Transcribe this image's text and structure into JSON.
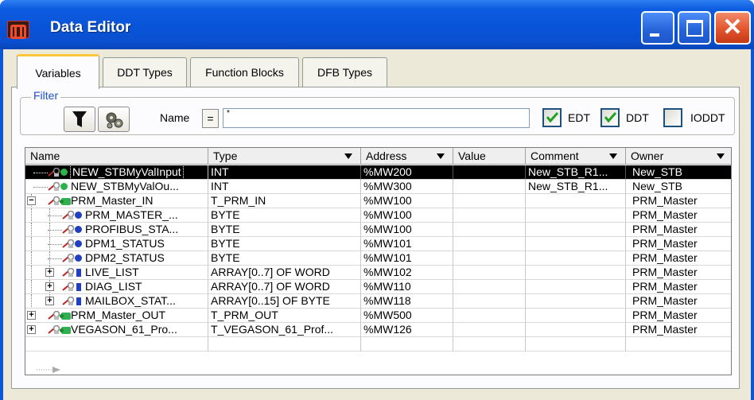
{
  "window": {
    "title": "Data Editor"
  },
  "tabs": [
    {
      "label": "Variables",
      "active": true
    },
    {
      "label": "DDT Types",
      "active": false
    },
    {
      "label": "Function Blocks",
      "active": false
    },
    {
      "label": "DFB Types",
      "active": false
    }
  ],
  "filter": {
    "legend": "Filter",
    "name_label": "Name",
    "operator": "=",
    "name_value": "*",
    "checkboxes": [
      {
        "label": "EDT",
        "checked": true
      },
      {
        "label": "DDT",
        "checked": true
      },
      {
        "label": "IODDT",
        "checked": false
      }
    ]
  },
  "grid": {
    "columns": [
      "Name",
      "Type",
      "Address",
      "Value",
      "Comment",
      "Owner"
    ],
    "rows": [
      {
        "name": "NEW_STBMyValInput",
        "type": "INT",
        "address": "%MW200",
        "value": "",
        "comment": "New_STB_R1...",
        "owner": "New_STB",
        "selected": true
      },
      {
        "name": "NEW_STBMyValOu...",
        "type": "INT",
        "address": "%MW300",
        "value": "",
        "comment": "New_STB_R1...",
        "owner": "New_STB"
      },
      {
        "name": "PRM_Master_IN",
        "type": "T_PRM_IN",
        "address": "%MW100",
        "value": "",
        "comment": "",
        "owner": "PRM_Master"
      },
      {
        "name": "PRM_MASTER_...",
        "type": "BYTE",
        "address": "%MW100",
        "value": "",
        "comment": "",
        "owner": "PRM_Master"
      },
      {
        "name": "PROFIBUS_STA...",
        "type": "BYTE",
        "address": "%MW100",
        "value": "",
        "comment": "",
        "owner": "PRM_Master"
      },
      {
        "name": "DPM1_STATUS",
        "type": "BYTE",
        "address": "%MW101",
        "value": "",
        "comment": "",
        "owner": "PRM_Master"
      },
      {
        "name": "DPM2_STATUS",
        "type": "BYTE",
        "address": "%MW101",
        "value": "",
        "comment": "",
        "owner": "PRM_Master"
      },
      {
        "name": "LIVE_LIST",
        "type": "ARRAY[0..7] OF WORD",
        "address": "%MW102",
        "value": "",
        "comment": "",
        "owner": "PRM_Master"
      },
      {
        "name": "DIAG_LIST",
        "type": "ARRAY[0..7] OF WORD",
        "address": "%MW110",
        "value": "",
        "comment": "",
        "owner": "PRM_Master"
      },
      {
        "name": "MAILBOX_STAT...",
        "type": "ARRAY[0..15] OF BYTE",
        "address": "%MW118",
        "value": "",
        "comment": "",
        "owner": "PRM_Master"
      },
      {
        "name": "PRM_Master_OUT",
        "type": "T_PRM_OUT",
        "address": "%MW500",
        "value": "",
        "comment": "",
        "owner": "PRM_Master"
      },
      {
        "name": "VEGASON_61_Pro...",
        "type": "T_VEGASON_61_Prof...",
        "address": "%MW126",
        "value": "",
        "comment": "",
        "owner": "PRM_Master"
      }
    ]
  },
  "icons": {
    "filter_button": "funnel-icon",
    "instance_button": "gear-icon",
    "row_key": "key-icon"
  },
  "colors": {
    "title_bar": "#0854d8",
    "selected_row": "#000000",
    "tab_highlight": "#ffc83c",
    "filter_legend": "#1c50d0"
  }
}
